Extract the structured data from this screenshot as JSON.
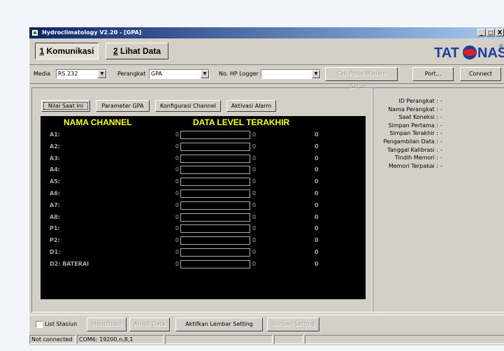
{
  "window": {
    "title": "Hydroclimatology V2.20 - [GPA]",
    "min_label": "_",
    "max_label": "□",
    "close_label": "X"
  },
  "tabs": [
    {
      "key": "1",
      "label": " Komunikasi"
    },
    {
      "key": "2",
      "label": " Lihat Data"
    }
  ],
  "logo": {
    "text_left": "TAT",
    "text_right": "NAS",
    "registered": "®",
    "color": "#1c3f94",
    "accent": "#d8232a"
  },
  "toolbar": {
    "media_label": "Media",
    "media_value": "RS 232",
    "perangkat_label": "Perangkat",
    "perangkat_value": "GPA",
    "hp_label": "No. HP Logger",
    "hp_value": "",
    "cek_pulsa": "Cek Pulsa Modem Server...",
    "port": "Port...",
    "connect": "Connect"
  },
  "subtabs": [
    "Nilai Saat Ini",
    "Parameter GPA",
    "Konfigurasi Channel",
    "Aktivasi Alarm"
  ],
  "grid": {
    "header_name": "NAMA CHANNEL",
    "header_data": "DATA LEVEL TERAKHIR",
    "rows": [
      {
        "name": "A1:",
        "v1": "0",
        "v2": "0",
        "v3": "0"
      },
      {
        "name": "A2:",
        "v1": "0",
        "v2": "0",
        "v3": "0"
      },
      {
        "name": "A3:",
        "v1": "0",
        "v2": "0",
        "v3": "0"
      },
      {
        "name": "A4:",
        "v1": "0",
        "v2": "0",
        "v3": "0"
      },
      {
        "name": "A5:",
        "v1": "0",
        "v2": "0",
        "v3": "0"
      },
      {
        "name": "A6:",
        "v1": "0",
        "v2": "0",
        "v3": "0"
      },
      {
        "name": "A7:",
        "v1": "0",
        "v2": "0",
        "v3": "0"
      },
      {
        "name": "A8:",
        "v1": "0",
        "v2": "0",
        "v3": "0"
      },
      {
        "name": "P1:",
        "v1": "0",
        "v2": "0",
        "v3": "0"
      },
      {
        "name": "P2:",
        "v1": "0",
        "v2": "0",
        "v3": "0"
      },
      {
        "name": "D1:",
        "v1": "0",
        "v2": "0",
        "v3": "0"
      },
      {
        "name": "D2: BATERAI",
        "v1": "0",
        "v2": "0",
        "v3": "0"
      }
    ]
  },
  "info": [
    {
      "label": "ID Perangkat :",
      "value": "-"
    },
    {
      "label": "Nama Perangkat :",
      "value": "-"
    },
    {
      "label": "Saat Koneksi :",
      "value": "-"
    },
    {
      "label": "Simpan Pertama :",
      "value": "-"
    },
    {
      "label": "Simpan Terakhir :",
      "value": "-"
    },
    {
      "label": "Pengambilan Data :",
      "value": "-"
    },
    {
      "label": "Tanggal Kalibrasi :",
      "value": "-"
    },
    {
      "label": "Tindih Memori :",
      "value": "-"
    },
    {
      "label": "Memori Terpakai :",
      "value": "-"
    }
  ],
  "bottom": {
    "list_stasiun": "List Stasiun",
    "identifikasi": "Identifikasi",
    "ambil_data": "Ambil Data",
    "aktifkan": "Aktifkan Lembar Setting",
    "simpan": "Simpan Setting"
  },
  "status": {
    "connection": "Not connected",
    "port": "COM6: 19200,n,8,1"
  }
}
